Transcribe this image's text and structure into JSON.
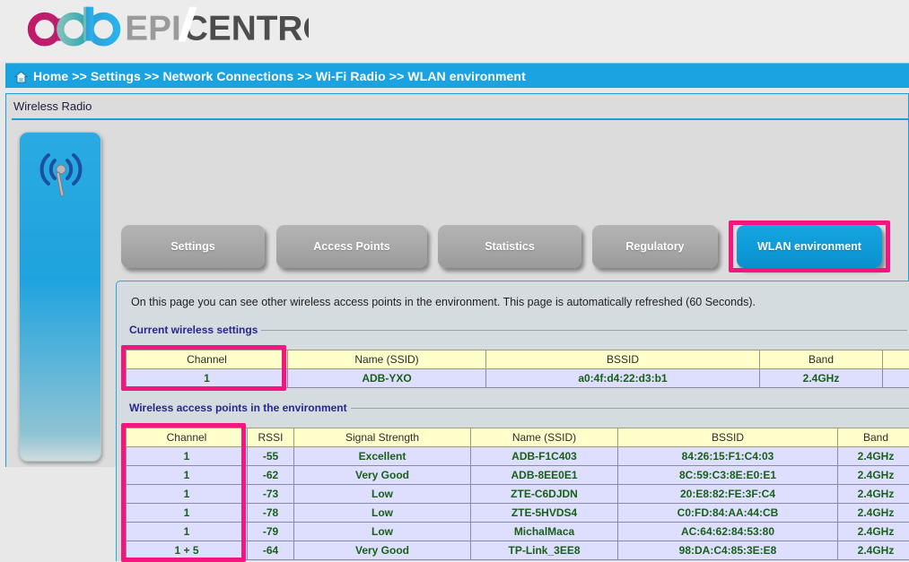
{
  "brand": {
    "mark_text": "adb",
    "word_light": "EPI",
    "word_dark": "CENTRO",
    "colors": {
      "magenta": "#c2186a",
      "teal": "#3aa9a6",
      "blue": "#29a8e0",
      "word_light": "#9a9a9a",
      "word_dark": "#4d4d4d"
    }
  },
  "breadcrumb": {
    "home_icon": "home-icon",
    "items": [
      "Home",
      "Settings",
      "Network Connections",
      "Wi-Fi Radio",
      "WLAN environment"
    ],
    "separator": ">>",
    "bar_color": "#1aa3e0"
  },
  "window": {
    "title": "Wireless Radio",
    "side_panel_icon": "wireless-antenna-icon",
    "accent_color": "#1a9fd9"
  },
  "tabs": [
    {
      "label": "Settings",
      "active": false
    },
    {
      "label": "Access Points",
      "active": false
    },
    {
      "label": "Statistics",
      "active": false
    },
    {
      "label": "Regulatory",
      "active": false
    },
    {
      "label": "WLAN environment",
      "active": true
    }
  ],
  "highlight_color": "#f5157f",
  "content": {
    "intro": "On this page you can see other wireless access points in the environment. This page is automatically refreshed (60 Seconds).",
    "current_settings": {
      "legend": "Current wireless settings",
      "columns": [
        "Channel",
        "Name (SSID)",
        "BSSID",
        "Band",
        ""
      ],
      "rows": [
        [
          "1",
          "ADB-YXO",
          "a0:4f:d4:22:d3:b1",
          "2.4GHz",
          ""
        ]
      ]
    },
    "environment": {
      "legend": "Wireless access points in the environment",
      "columns": [
        "Channel",
        "RSSI",
        "Signal Strength",
        "Name (SSID)",
        "BSSID",
        "Band"
      ],
      "rows": [
        [
          "1",
          "-55",
          "Excellent",
          "ADB-F1C403",
          "84:26:15:F1:C4:03",
          "2.4GHz"
        ],
        [
          "1",
          "-62",
          "Very Good",
          "ADB-8EE0E1",
          "8C:59:C3:8E:E0:E1",
          "2.4GHz"
        ],
        [
          "1",
          "-73",
          "Low",
          "ZTE-C6DJDN",
          "20:E8:82:FE:3F:C4",
          "2.4GHz"
        ],
        [
          "1",
          "-78",
          "Low",
          "ZTE-5HVDS4",
          "C0:FD:84:AA:44:CB",
          "2.4GHz"
        ],
        [
          "1",
          "-79",
          "Low",
          "MichalMaca",
          "AC:64:62:84:53:80",
          "2.4GHz"
        ],
        [
          "1 + 5",
          "-64",
          "Very Good",
          "TP-Link_3EE8",
          "98:DA:C4:85:3E:E8",
          "2.4GHz"
        ]
      ]
    }
  }
}
